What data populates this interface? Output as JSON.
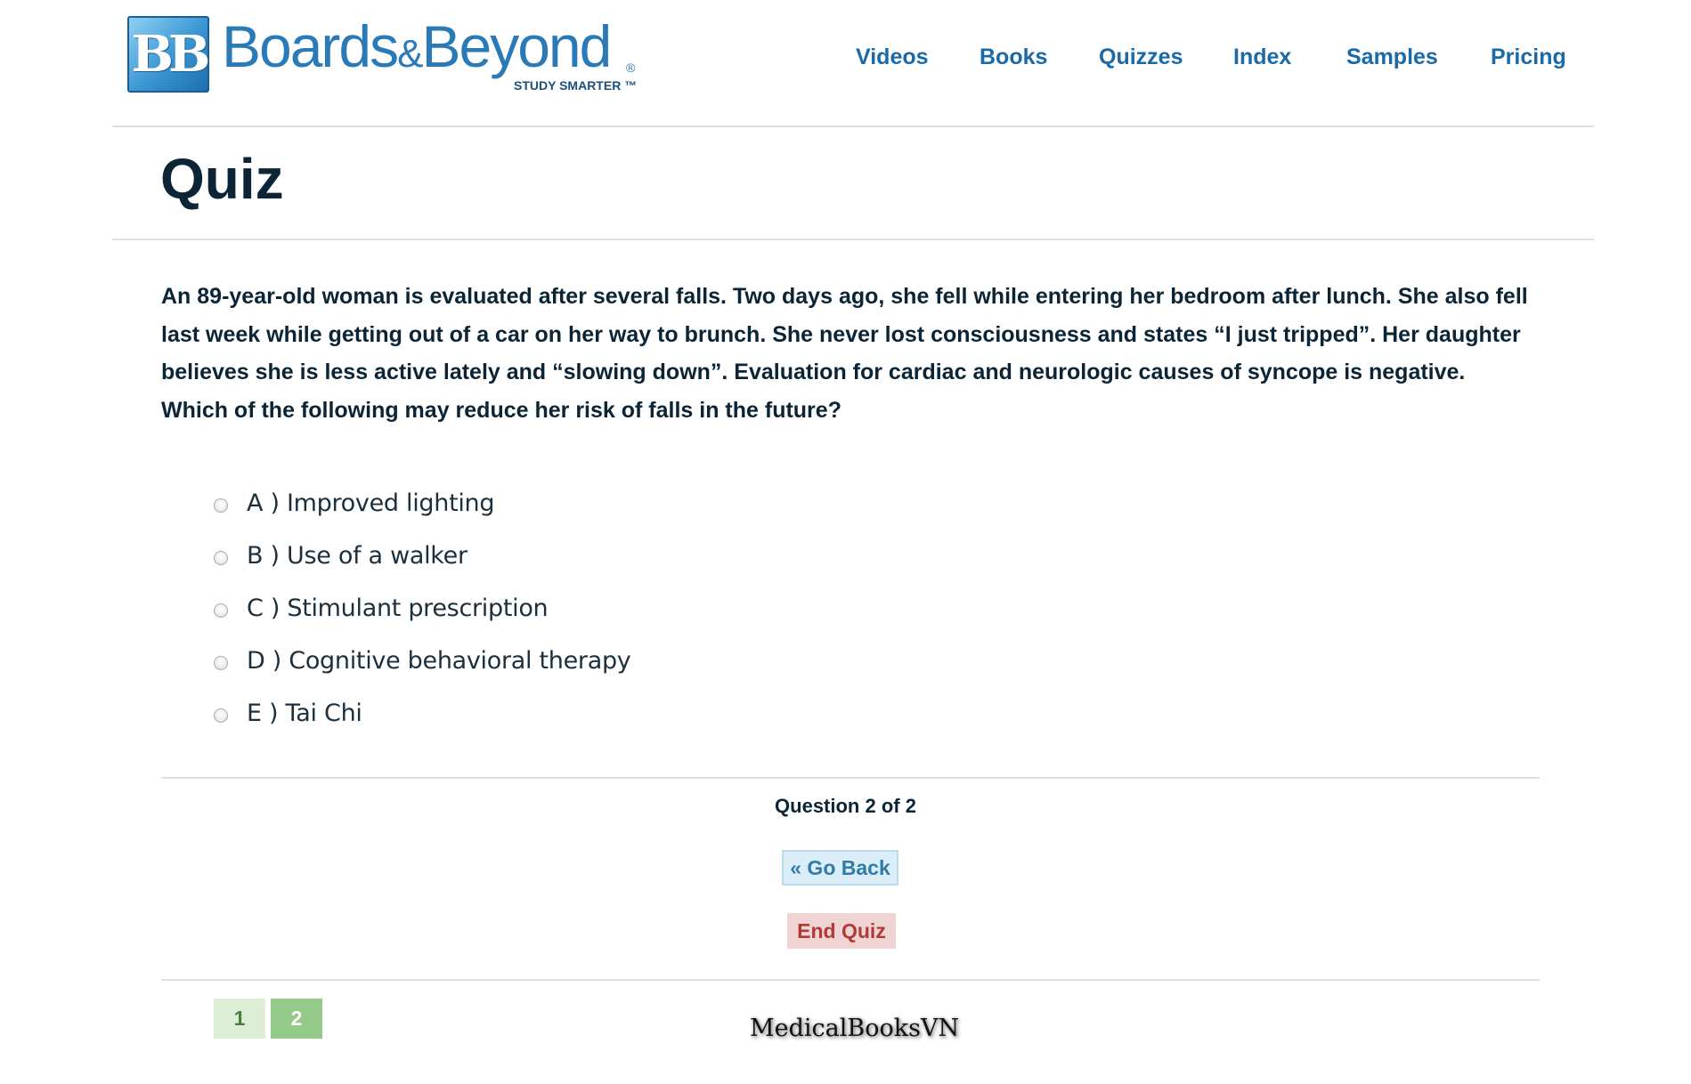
{
  "header": {
    "logo": {
      "mark": "BB",
      "word1": "Boards",
      "amp": "&",
      "word2": "Beyond",
      "reg": "®",
      "tagline": "STUDY SMARTER ™"
    },
    "nav": [
      {
        "id": "videos",
        "label": "Videos"
      },
      {
        "id": "books",
        "label": "Books"
      },
      {
        "id": "quizzes",
        "label": "Quizzes"
      },
      {
        "id": "index",
        "label": "Index"
      },
      {
        "id": "samples",
        "label": "Samples"
      },
      {
        "id": "pricing",
        "label": "Pricing"
      }
    ]
  },
  "page": {
    "title": "Quiz"
  },
  "quiz": {
    "question": "An 89-year-old woman is evaluated after several falls. Two days ago, she fell while entering her bedroom after lunch. She also fell last week while getting out of a car on her way to brunch. She never lost consciousness and states “I just tripped”. Her daughter believes she is less active lately and “slowing down”. Evaluation for cardiac and neurologic causes of syncope is negative. Which of the following may reduce her risk of falls in the future?",
    "options": [
      {
        "letter": "A",
        "label": "A ) Improved lighting"
      },
      {
        "letter": "B",
        "label": "B ) Use of a walker"
      },
      {
        "letter": "C",
        "label": "C ) Stimulant prescription"
      },
      {
        "letter": "D",
        "label": "D ) Cognitive behavioral therapy"
      },
      {
        "letter": "E",
        "label": "E ) Tai Chi"
      }
    ],
    "progress": "Question 2 of 2",
    "go_back_label": "« Go Back",
    "end_quiz_label": "End Quiz",
    "pages": [
      {
        "label": "1"
      },
      {
        "label": "2"
      }
    ]
  },
  "watermark": "MedicalBooksVN",
  "colors": {
    "nav_link": "#1a6aa8",
    "heading": "#0b2536",
    "go_back_bg": "#dbeef7",
    "end_quiz_bg": "#f0d3d3",
    "page_active_bg": "#94c98a",
    "page_inactive_bg": "#dcefd6"
  }
}
